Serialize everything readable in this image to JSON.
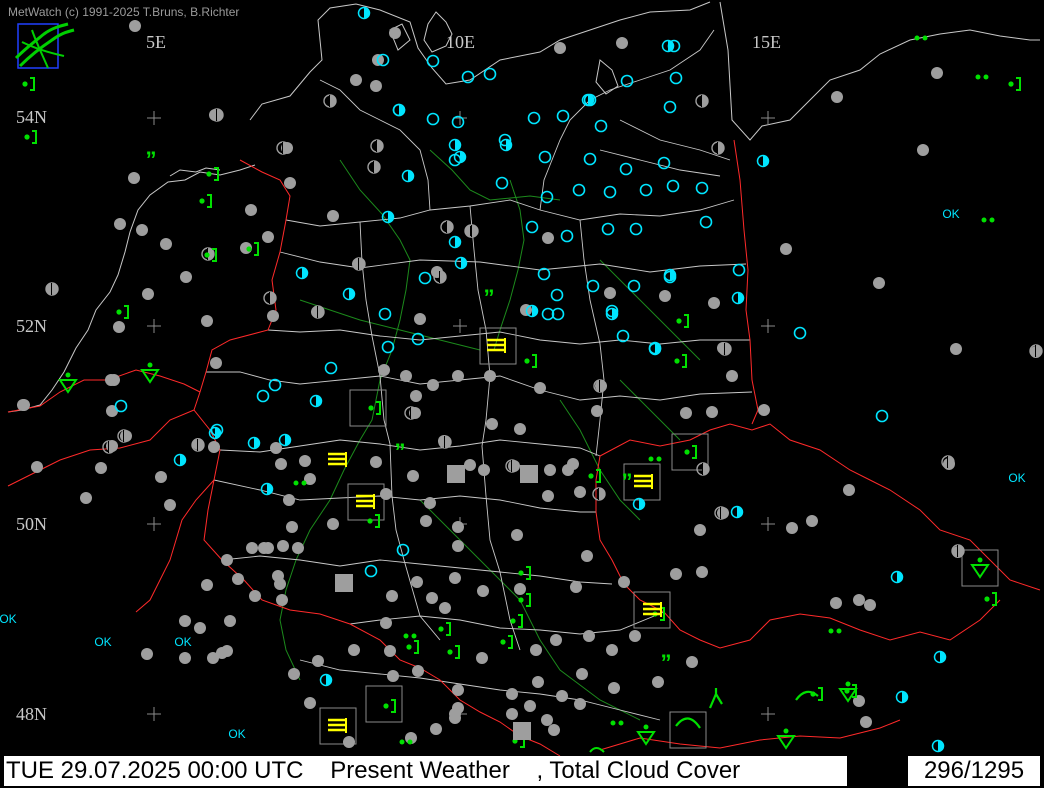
{
  "copyright": "MetWatch  (c) 1991-2025 T.Bruns, B.Richter",
  "longitude_labels": [
    "5E",
    "10E",
    "15E"
  ],
  "latitude_labels": [
    "54N",
    "52N",
    "50N",
    "48N"
  ],
  "statusbar": {
    "datetime": "TUE 29.07.2025 00:00 UTC",
    "param1": "Present Weather",
    "param2": ", Total Cloud Cover",
    "frame_counter": "296/1295"
  },
  "colors": {
    "background": "#000000",
    "coast_border": "#c8c8c8",
    "national_border": "#ff2a2a",
    "rivers": "#1c8a1c",
    "cloud_overcast": "#9e9e9e",
    "cloud_clear": "#00e5ff",
    "drizzle": "#00e000",
    "fog": "#ffff00"
  },
  "legend_symbols": {
    "gray_filled_circle": "overcast",
    "cyan_open_circle": "clear sky",
    "cyan_half_circle": "partly cloudy",
    "ok_text": "OK",
    "green_drizzle": "drizzle",
    "yellow_lines": "fog"
  }
}
